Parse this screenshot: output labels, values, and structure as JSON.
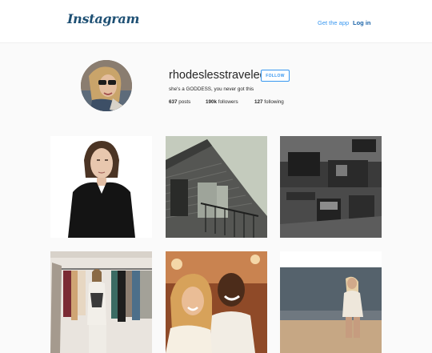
{
  "header": {
    "logo_text": "Instagram",
    "get_app_label": "Get the app",
    "login_label": "Log in"
  },
  "profile": {
    "username": "rhodeslesstraveled",
    "follow_label": "FOLLOW",
    "bio": "she's a GODDESS, you never got this",
    "stats": {
      "posts_count": "637",
      "posts_label": "posts",
      "followers_count": "190k",
      "followers_label": "followers",
      "following_count": "127",
      "following_label": "following"
    }
  },
  "colors": {
    "link_blue": "#3897f0",
    "logo_navy": "#1d4f73",
    "background": "#fafafa"
  }
}
